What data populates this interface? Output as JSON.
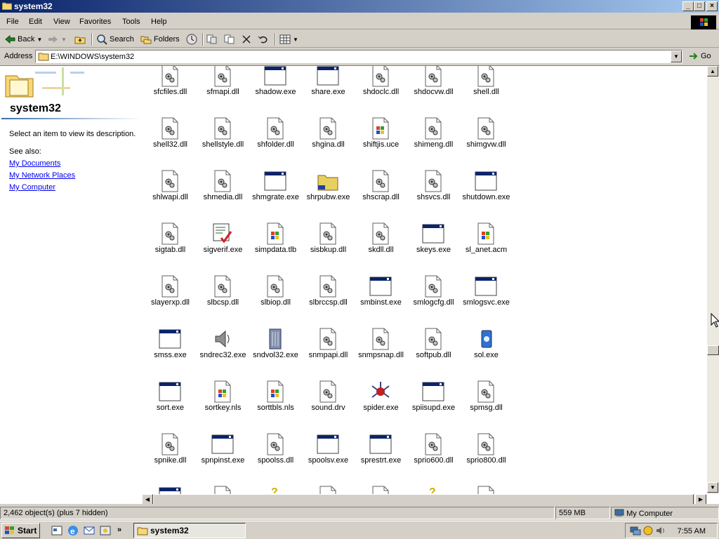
{
  "window": {
    "title": "system32",
    "buttons": {
      "minimize": "_",
      "maximize": "□",
      "close": "×"
    }
  },
  "menu": [
    "File",
    "Edit",
    "View",
    "Favorites",
    "Tools",
    "Help"
  ],
  "toolbar": {
    "back": "Back",
    "search": "Search",
    "folders": "Folders"
  },
  "address": {
    "label": "Address",
    "value": "E:\\WINDOWS\\system32",
    "go": "Go"
  },
  "leftpane": {
    "title": "system32",
    "description": "Select an item to view its description.",
    "see_also": "See also:",
    "links": [
      "My Documents",
      "My Network Places",
      "My Computer"
    ]
  },
  "files": [
    {
      "name": "sfcfiles.dll",
      "icon": "dll"
    },
    {
      "name": "sfmapi.dll",
      "icon": "dll"
    },
    {
      "name": "shadow.exe",
      "icon": "exe"
    },
    {
      "name": "share.exe",
      "icon": "exe"
    },
    {
      "name": "shdoclc.dll",
      "icon": "dll"
    },
    {
      "name": "shdocvw.dll",
      "icon": "dll"
    },
    {
      "name": "shell.dll",
      "icon": "dll"
    },
    {
      "name": "shell32.dll",
      "icon": "dll"
    },
    {
      "name": "shellstyle.dll",
      "icon": "dll"
    },
    {
      "name": "shfolder.dll",
      "icon": "dll"
    },
    {
      "name": "shgina.dll",
      "icon": "dll"
    },
    {
      "name": "shiftjis.uce",
      "icon": "winfile"
    },
    {
      "name": "shimeng.dll",
      "icon": "dll"
    },
    {
      "name": "shimgvw.dll",
      "icon": "dll"
    },
    {
      "name": "shlwapi.dll",
      "icon": "dll"
    },
    {
      "name": "shmedia.dll",
      "icon": "dll"
    },
    {
      "name": "shmgrate.exe",
      "icon": "exe"
    },
    {
      "name": "shrpubw.exe",
      "icon": "folder-share"
    },
    {
      "name": "shscrap.dll",
      "icon": "dll"
    },
    {
      "name": "shsvcs.dll",
      "icon": "dll"
    },
    {
      "name": "shutdown.exe",
      "icon": "exe"
    },
    {
      "name": "sigtab.dll",
      "icon": "dll"
    },
    {
      "name": "sigverif.exe",
      "icon": "sigverif"
    },
    {
      "name": "simpdata.tlb",
      "icon": "winfile"
    },
    {
      "name": "sisbkup.dll",
      "icon": "dll"
    },
    {
      "name": "skdll.dll",
      "icon": "dll"
    },
    {
      "name": "skeys.exe",
      "icon": "exe"
    },
    {
      "name": "sl_anet.acm",
      "icon": "winfile"
    },
    {
      "name": "slayerxp.dll",
      "icon": "dll"
    },
    {
      "name": "slbcsp.dll",
      "icon": "dll"
    },
    {
      "name": "slbiop.dll",
      "icon": "dll"
    },
    {
      "name": "slbrccsp.dll",
      "icon": "dll"
    },
    {
      "name": "smbinst.exe",
      "icon": "exe"
    },
    {
      "name": "smlogcfg.dll",
      "icon": "dll"
    },
    {
      "name": "smlogsvc.exe",
      "icon": "exe"
    },
    {
      "name": "smss.exe",
      "icon": "exe"
    },
    {
      "name": "sndrec32.exe",
      "icon": "speaker"
    },
    {
      "name": "sndvol32.exe",
      "icon": "volume"
    },
    {
      "name": "snmpapi.dll",
      "icon": "dll"
    },
    {
      "name": "snmpsnap.dll",
      "icon": "dll"
    },
    {
      "name": "softpub.dll",
      "icon": "dll"
    },
    {
      "name": "sol.exe",
      "icon": "cards"
    },
    {
      "name": "sort.exe",
      "icon": "exe"
    },
    {
      "name": "sortkey.nls",
      "icon": "winfile"
    },
    {
      "name": "sorttbls.nls",
      "icon": "winfile"
    },
    {
      "name": "sound.drv",
      "icon": "dll"
    },
    {
      "name": "spider.exe",
      "icon": "spider"
    },
    {
      "name": "spiisupd.exe",
      "icon": "exe"
    },
    {
      "name": "spmsg.dll",
      "icon": "dll"
    },
    {
      "name": "spnike.dll",
      "icon": "dll"
    },
    {
      "name": "spnpinst.exe",
      "icon": "exe"
    },
    {
      "name": "spoolss.dll",
      "icon": "dll"
    },
    {
      "name": "spoolsv.exe",
      "icon": "exe"
    },
    {
      "name": "sprestrt.exe",
      "icon": "exe"
    },
    {
      "name": "sprio600.dll",
      "icon": "dll"
    },
    {
      "name": "sprio800.dll",
      "icon": "dll"
    },
    {
      "name": "",
      "icon": "exe"
    },
    {
      "name": "",
      "icon": "dll"
    },
    {
      "name": "",
      "icon": "help"
    },
    {
      "name": "",
      "icon": "dll"
    },
    {
      "name": "",
      "icon": "winfile"
    },
    {
      "name": "",
      "icon": "help"
    },
    {
      "name": "",
      "icon": "dll"
    }
  ],
  "status": {
    "objects": "2,462 object(s) (plus 7 hidden)",
    "size": "559 MB",
    "location": "My Computer"
  },
  "taskbar": {
    "start": "Start",
    "task": "system32",
    "chevron": "»",
    "clock": "7:55 AM"
  },
  "colors": {
    "title_start": "#0a246a",
    "title_end": "#a6caf0",
    "face": "#d4d0c8",
    "link": "#0000ee"
  }
}
